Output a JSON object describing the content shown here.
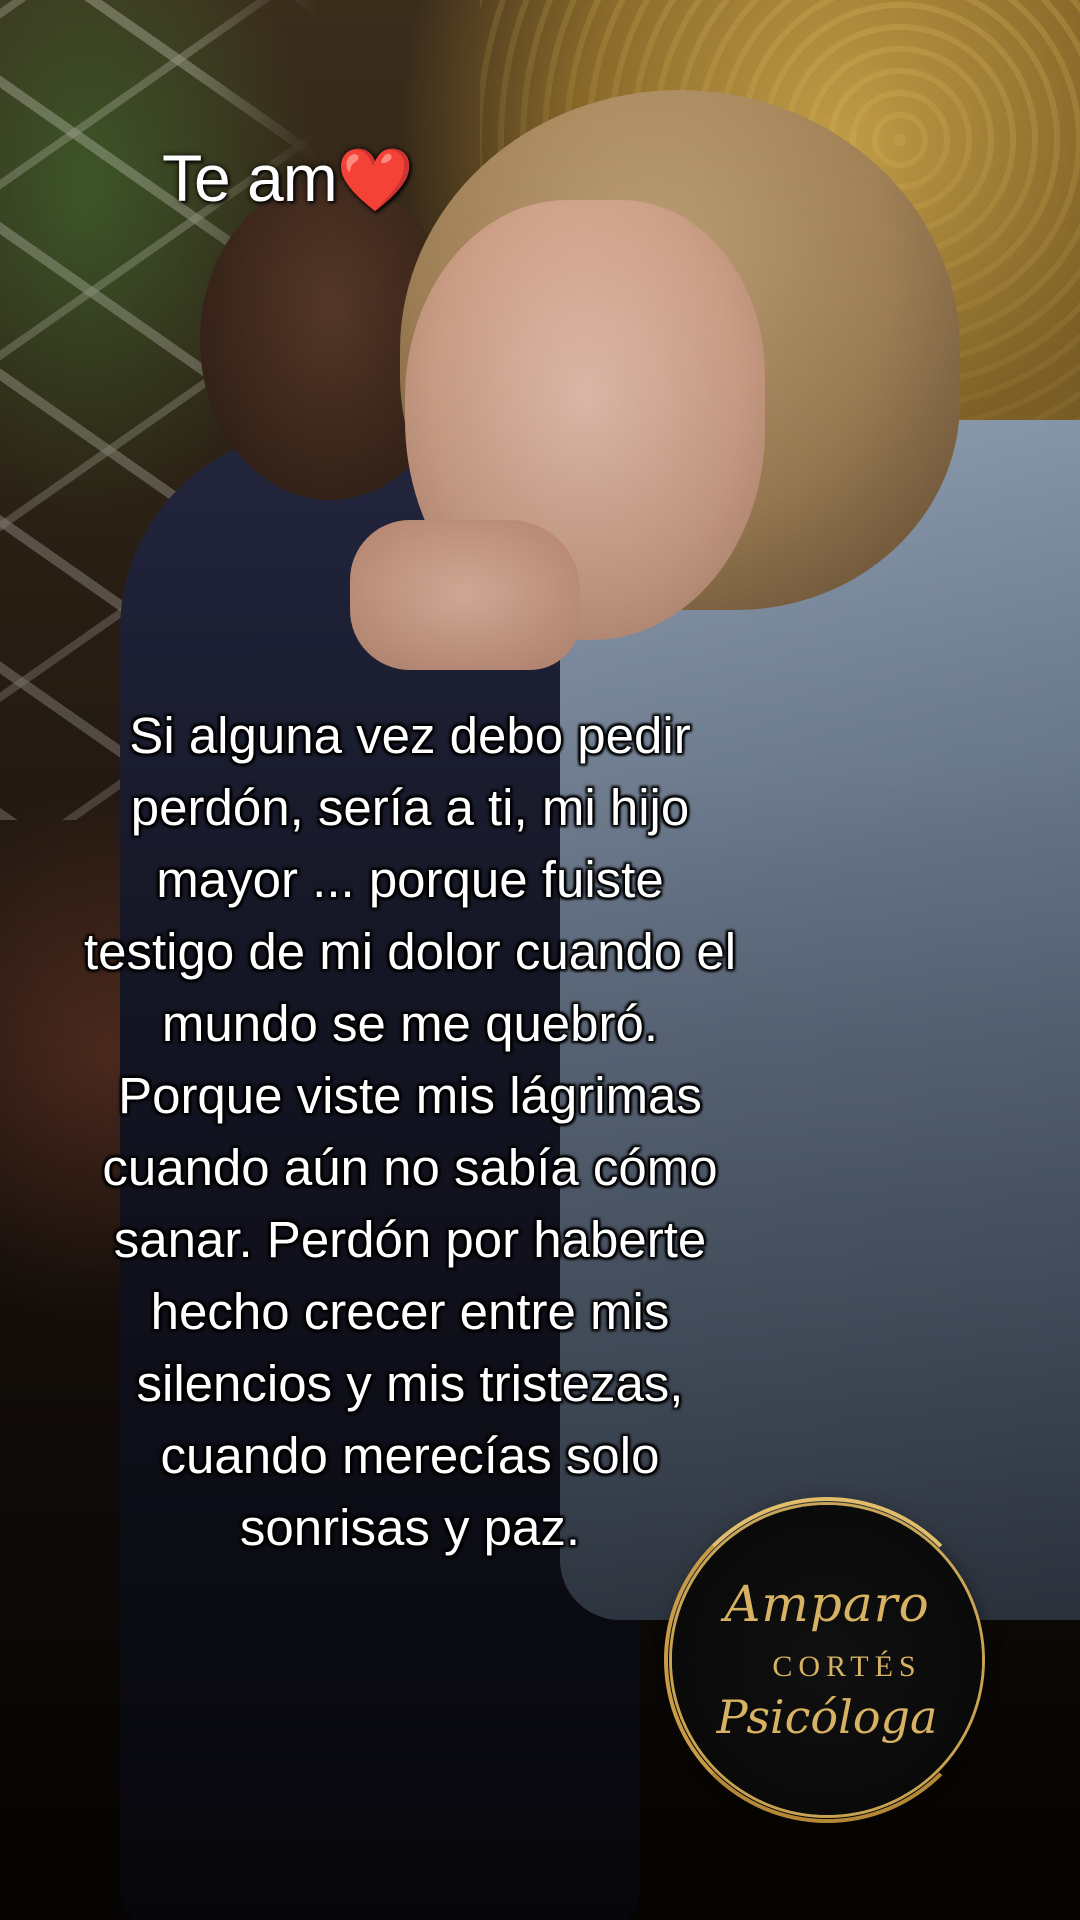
{
  "overlay": {
    "title_text": "Te am",
    "title_emoji": "❤️"
  },
  "message": {
    "text": "Si alguna vez debo pedir perdón, sería a ti, mi hijo mayor ... porque fuiste testigo de mi dolor cuando el mundo se me quebró. Porque viste mis lágrimas cuando aún no sabía cómo sanar. Perdón por haberte hecho crecer entre mis silencios y mis tristezas, cuando merecías solo sonrisas y paz."
  },
  "logo": {
    "line1": "Amparo",
    "line2": "CORTÉS",
    "line3": "Psicóloga"
  },
  "colors": {
    "heart": "#e0182a",
    "logo_gold": "#d7b262"
  }
}
